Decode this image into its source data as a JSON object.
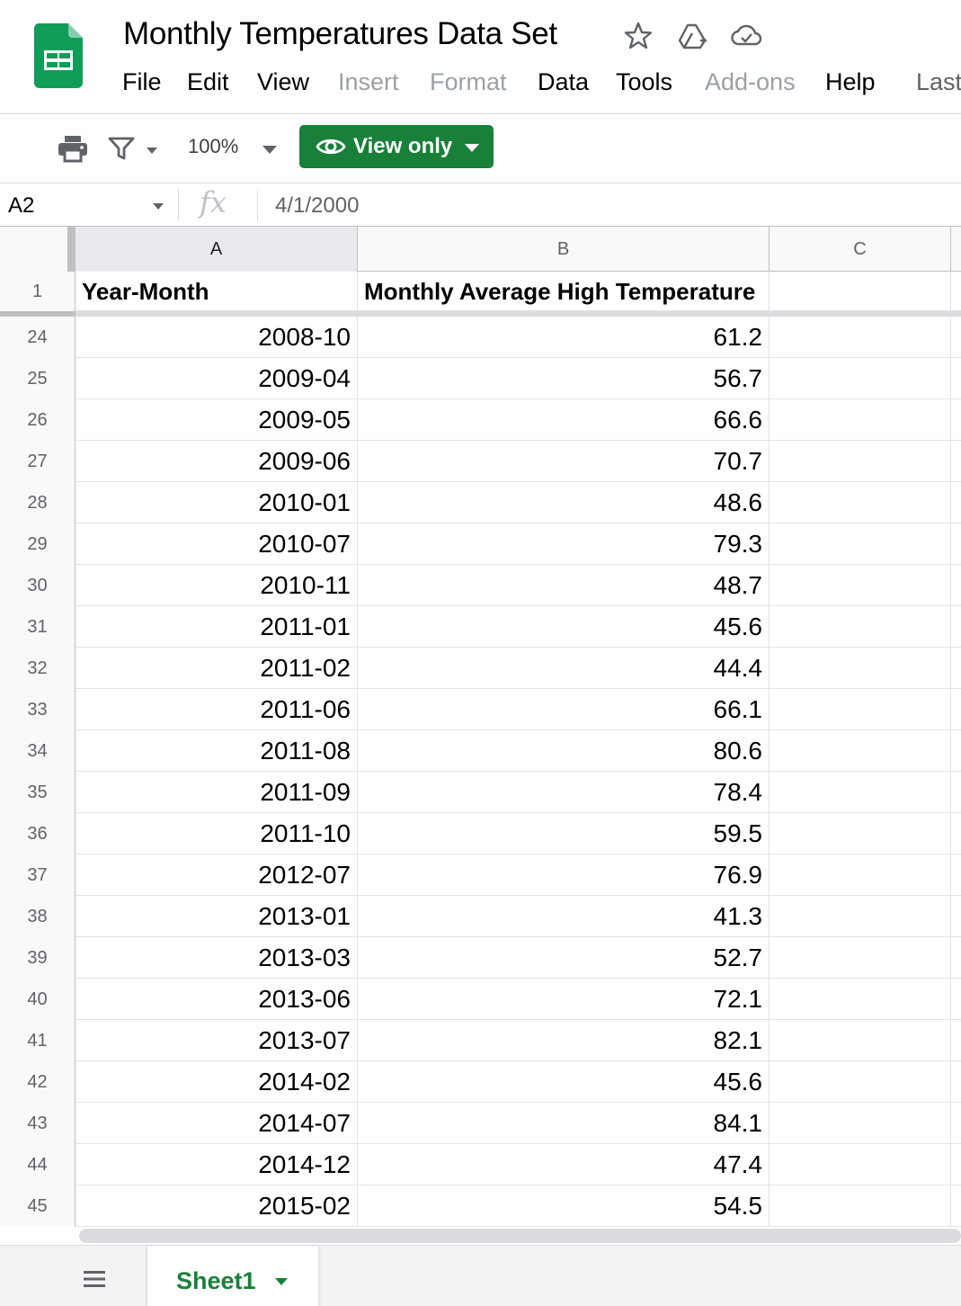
{
  "header": {
    "title": "Monthly Temperatures Data Set",
    "menu": [
      "File",
      "Edit",
      "View",
      "Insert",
      "Format",
      "Data",
      "Tools",
      "Add-ons",
      "Help",
      "Last"
    ]
  },
  "toolbar": {
    "zoom": "100%",
    "view_only_label": "View only"
  },
  "formula_bar": {
    "cell_ref": "A2",
    "value": "4/1/2000"
  },
  "grid": {
    "column_headers": [
      "A",
      "B",
      "C"
    ],
    "header_row": {
      "row_number": "1",
      "cells": [
        "Year-Month",
        "Monthly Average High Temperature"
      ]
    },
    "rows": [
      {
        "n": "24",
        "a": "2008-10",
        "b": "61.2"
      },
      {
        "n": "25",
        "a": "2009-04",
        "b": "56.7"
      },
      {
        "n": "26",
        "a": "2009-05",
        "b": "66.6"
      },
      {
        "n": "27",
        "a": "2009-06",
        "b": "70.7"
      },
      {
        "n": "28",
        "a": "2010-01",
        "b": "48.6"
      },
      {
        "n": "29",
        "a": "2010-07",
        "b": "79.3"
      },
      {
        "n": "30",
        "a": "2010-11",
        "b": "48.7"
      },
      {
        "n": "31",
        "a": "2011-01",
        "b": "45.6"
      },
      {
        "n": "32",
        "a": "2011-02",
        "b": "44.4"
      },
      {
        "n": "33",
        "a": "2011-06",
        "b": "66.1"
      },
      {
        "n": "34",
        "a": "2011-08",
        "b": "80.6"
      },
      {
        "n": "35",
        "a": "2011-09",
        "b": "78.4"
      },
      {
        "n": "36",
        "a": "2011-10",
        "b": "59.5"
      },
      {
        "n": "37",
        "a": "2012-07",
        "b": "76.9"
      },
      {
        "n": "38",
        "a": "2013-01",
        "b": "41.3"
      },
      {
        "n": "39",
        "a": "2013-03",
        "b": "52.7"
      },
      {
        "n": "40",
        "a": "2013-06",
        "b": "72.1"
      },
      {
        "n": "41",
        "a": "2013-07",
        "b": "82.1"
      },
      {
        "n": "42",
        "a": "2014-02",
        "b": "45.6"
      },
      {
        "n": "43",
        "a": "2014-07",
        "b": "84.1"
      },
      {
        "n": "44",
        "a": "2014-12",
        "b": "47.4"
      },
      {
        "n": "45",
        "a": "2015-02",
        "b": "54.5"
      }
    ]
  },
  "sheets": {
    "active": "Sheet1"
  },
  "colors": {
    "brand_green": "#188038",
    "sheets_logo_green": "#0f9d58",
    "header_bg": "#f8f9fa",
    "active_header_bg": "#e8eaed"
  },
  "icons": [
    "sheets-logo-icon",
    "star-icon",
    "move-to-drive-icon",
    "cloud-saved-icon",
    "print-icon",
    "filter-icon",
    "eye-icon",
    "all-sheets-icon"
  ]
}
